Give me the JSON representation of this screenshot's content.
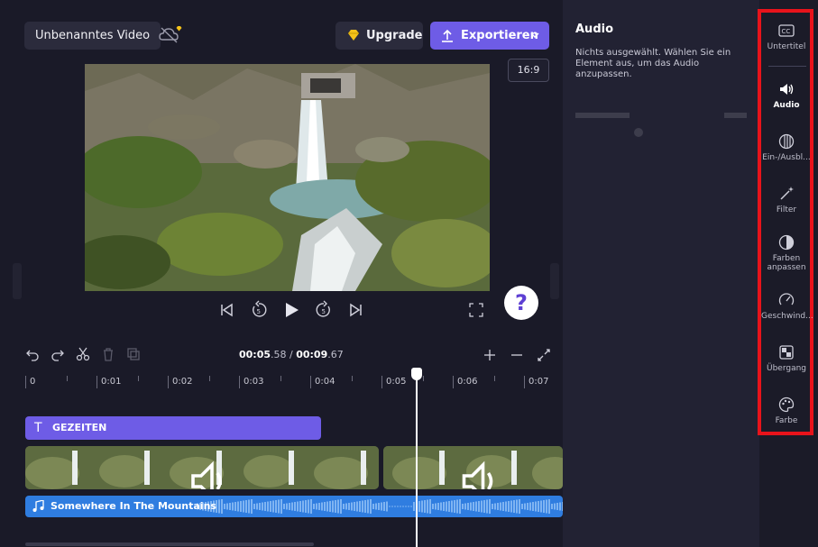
{
  "header": {
    "project_title": "Unbenanntes Video",
    "upgrade_label": "Upgrade",
    "export_label": "Exportieren",
    "aspect_ratio": "16:9"
  },
  "player": {
    "help_label": "?"
  },
  "timeline": {
    "current_time": "00:05",
    "current_frac": ".58",
    "separator": " / ",
    "total_time": "00:09",
    "total_frac": ".67",
    "ruler_ticks": [
      "0",
      "0:01",
      "0:02",
      "0:03",
      "0:04",
      "0:05",
      "0:06",
      "0:07"
    ],
    "text_clip_label": "GEZEITEN",
    "audio_clip_label": "Somewhere In The Mountains",
    "playhead_position": 5.58,
    "duration": 9.67
  },
  "audio_panel": {
    "title": "Audio",
    "description": "Nichts ausgewählt. Wählen Sie ein Element aus, um das Audio anzupassen."
  },
  "rail": {
    "items": [
      {
        "label": "Untertitel",
        "icon": "cc-icon"
      },
      {
        "label": "Audio",
        "icon": "speaker-icon",
        "active": true
      },
      {
        "label": "Ein-/Ausbl...",
        "icon": "fade-icon"
      },
      {
        "label": "Filter",
        "icon": "magic-wand-icon"
      },
      {
        "label": "Farben anpassen",
        "icon": "contrast-icon"
      },
      {
        "label": "Geschwind...",
        "icon": "speedometer-icon"
      },
      {
        "label": "Übergang",
        "icon": "transition-icon"
      },
      {
        "label": "Farbe",
        "icon": "palette-icon"
      }
    ]
  },
  "colors": {
    "accent": "#6e5ce6",
    "audio_track": "#2f7de0",
    "highlight_frame": "#e8131b"
  }
}
